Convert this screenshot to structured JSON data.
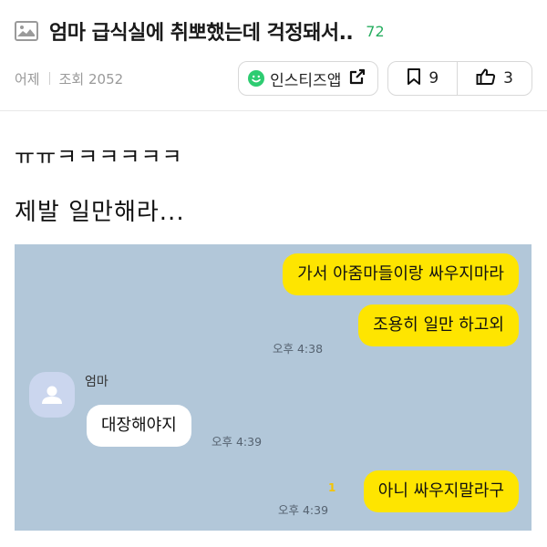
{
  "post": {
    "title": "엄마 급식실에 취뽀했는데 걱정돼서..",
    "comment_count": "72",
    "date": "어제",
    "views": "조회 2052",
    "share_label": "인스티즈앱",
    "bookmark_count": "9",
    "like_count": "3",
    "body_line1": "ㅠㅠㅋㅋㅋㅋㅋㅋ",
    "body_line2": "제발 일만해라..."
  },
  "chat": {
    "messages": [
      {
        "side": "me",
        "text": "가서 아줌마들이랑 싸우지마라"
      },
      {
        "side": "me",
        "text": "조용히 일만 하고외",
        "time": "오후 4:38"
      },
      {
        "side": "them",
        "sender": "엄마",
        "text": "대장해야지",
        "time": "오후 4:39"
      },
      {
        "side": "me",
        "text": "아니 싸우지말라구",
        "time": "오후 4:39",
        "unread": "1"
      }
    ]
  },
  "icons": {
    "title_icon": "image-icon",
    "share_icon": "external-link-icon",
    "bookmark_icon": "bookmark-icon",
    "like_icon": "thumbs-up-icon",
    "avatar_icon": "person-icon"
  },
  "colors": {
    "accent_green": "#27ae60",
    "chat_bg": "#b2c7d9",
    "my_bubble": "#fee500",
    "their_bubble": "#ffffff"
  }
}
